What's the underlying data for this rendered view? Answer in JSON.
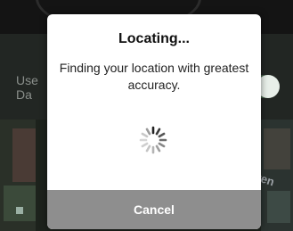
{
  "background": {
    "setting_label_line1": "Use",
    "setting_label_line2": "Da",
    "toggle_on": true,
    "map_caption": "lten"
  },
  "dialog": {
    "title": "Locating...",
    "message": "Finding your location with greatest accuracy.",
    "cancel_label": "Cancel",
    "spinner_icon": "activity-spinner-icon"
  },
  "colors": {
    "dialog_background": "#ffffff",
    "cancel_button": "#8e8e8e",
    "cancel_text": "#ffffff",
    "toggle_knob": "#e8efe9"
  }
}
